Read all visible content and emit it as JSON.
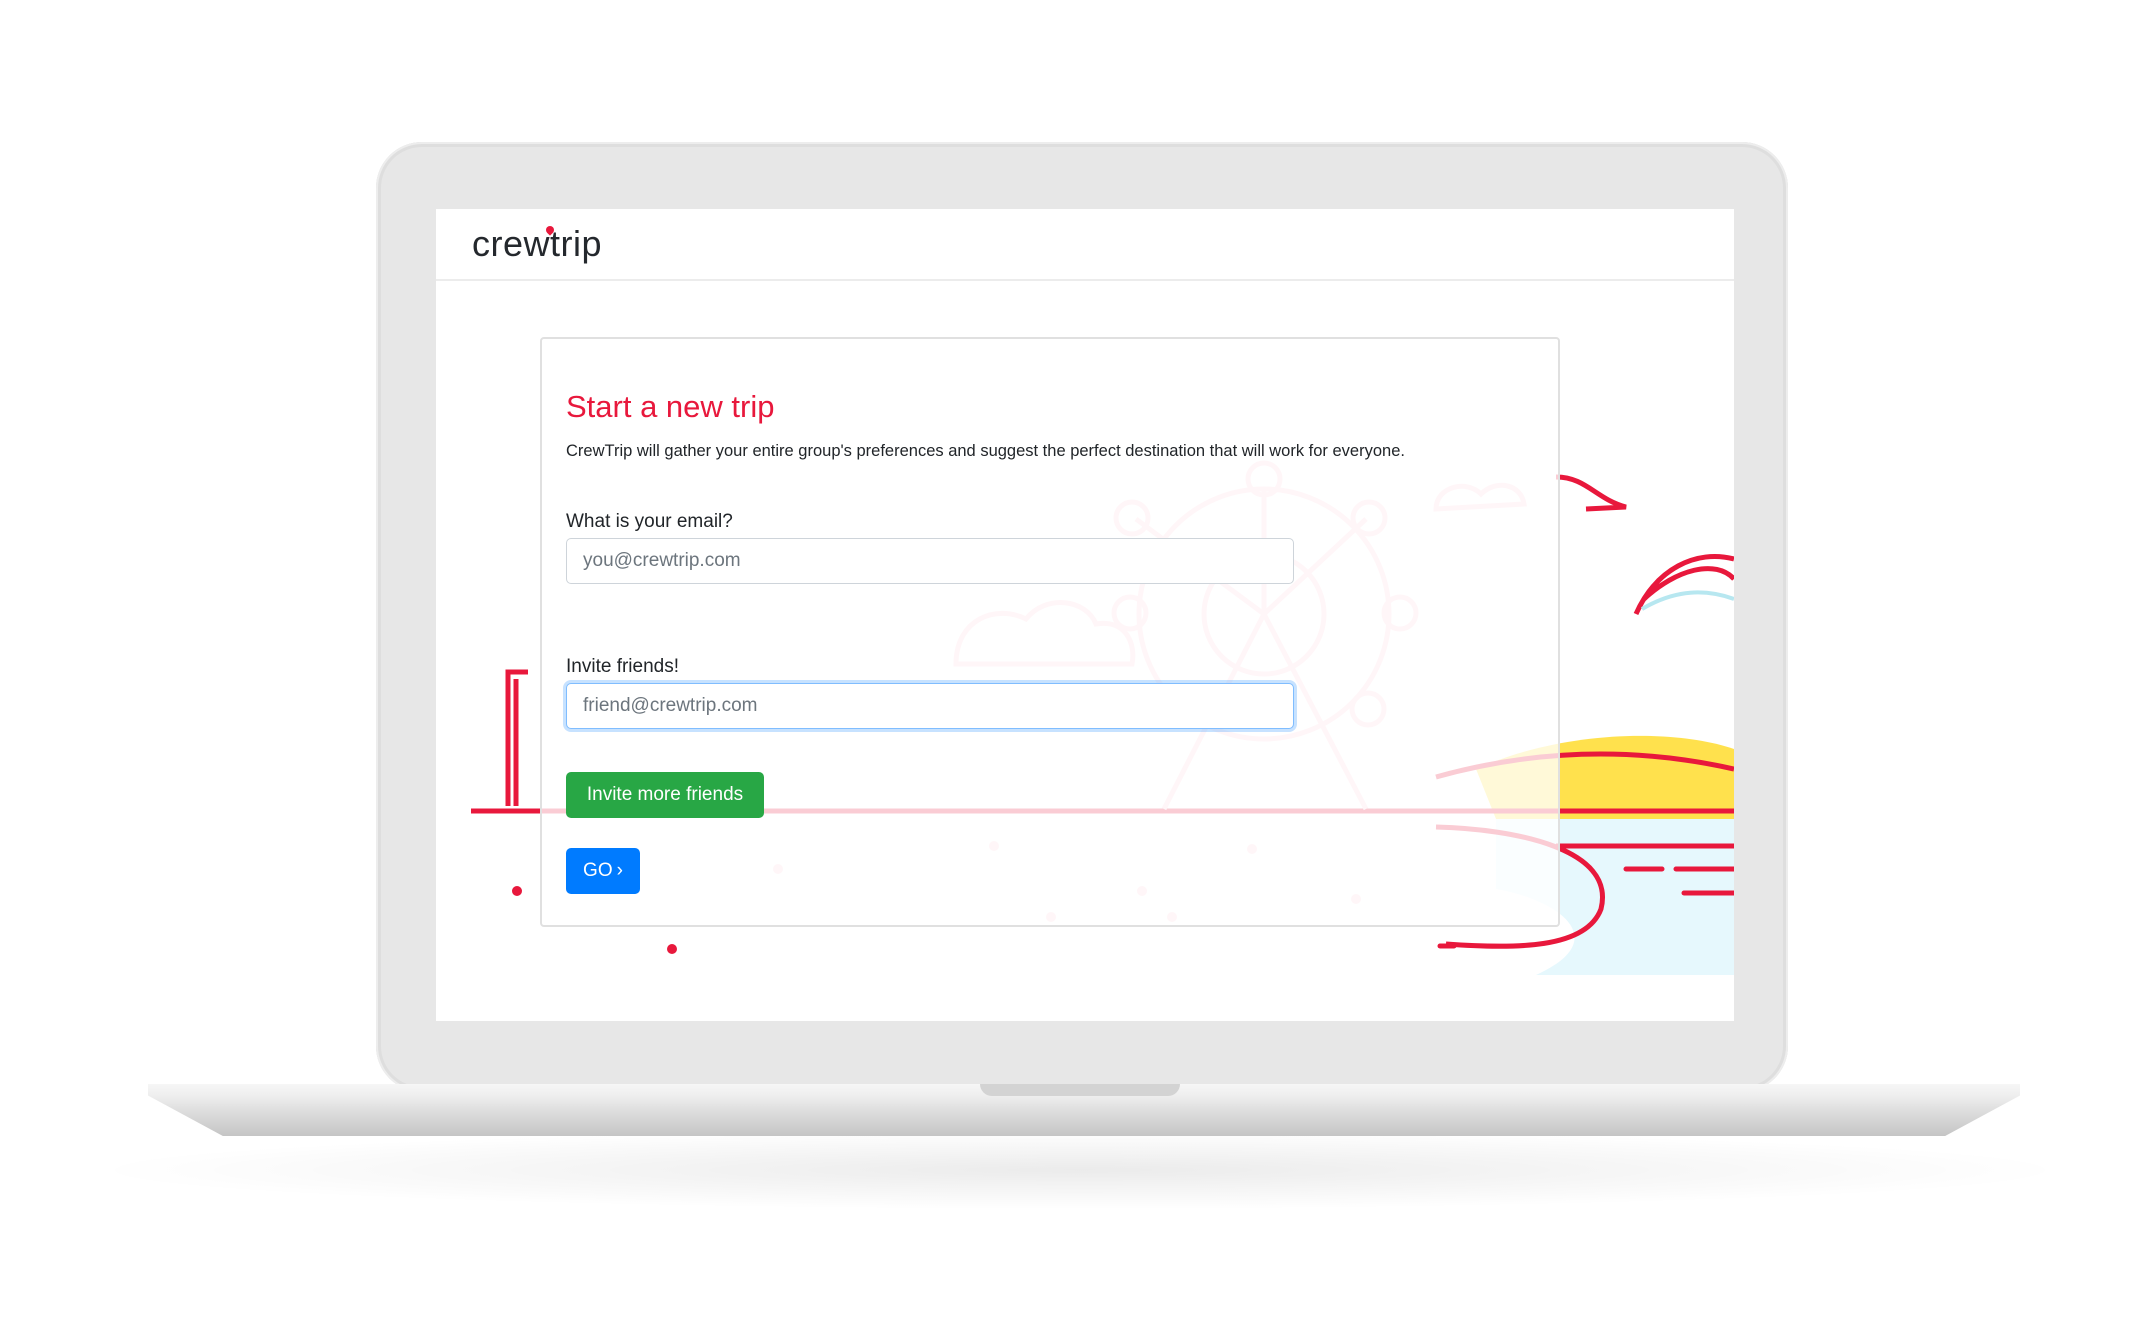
{
  "app": {
    "logo_text": "crewtrip",
    "brand_color": "#e8183c"
  },
  "form": {
    "title": "Start a new trip",
    "description": "CrewTrip will gather your entire group's preferences and suggest the perfect destination that will work for everyone.",
    "email_label": "What is your email?",
    "email_placeholder": "you@crewtrip.com",
    "friends_label": "Invite friends!",
    "friend_placeholder": "friend@crewtrip.com",
    "invite_button": "Invite more friends",
    "go_button": "GO",
    "go_icon": "chevron-right-icon"
  },
  "colors": {
    "title": "#e8183c",
    "invite_button": "#28a745",
    "go_button": "#007bff",
    "focus_border": "#80bdff"
  }
}
